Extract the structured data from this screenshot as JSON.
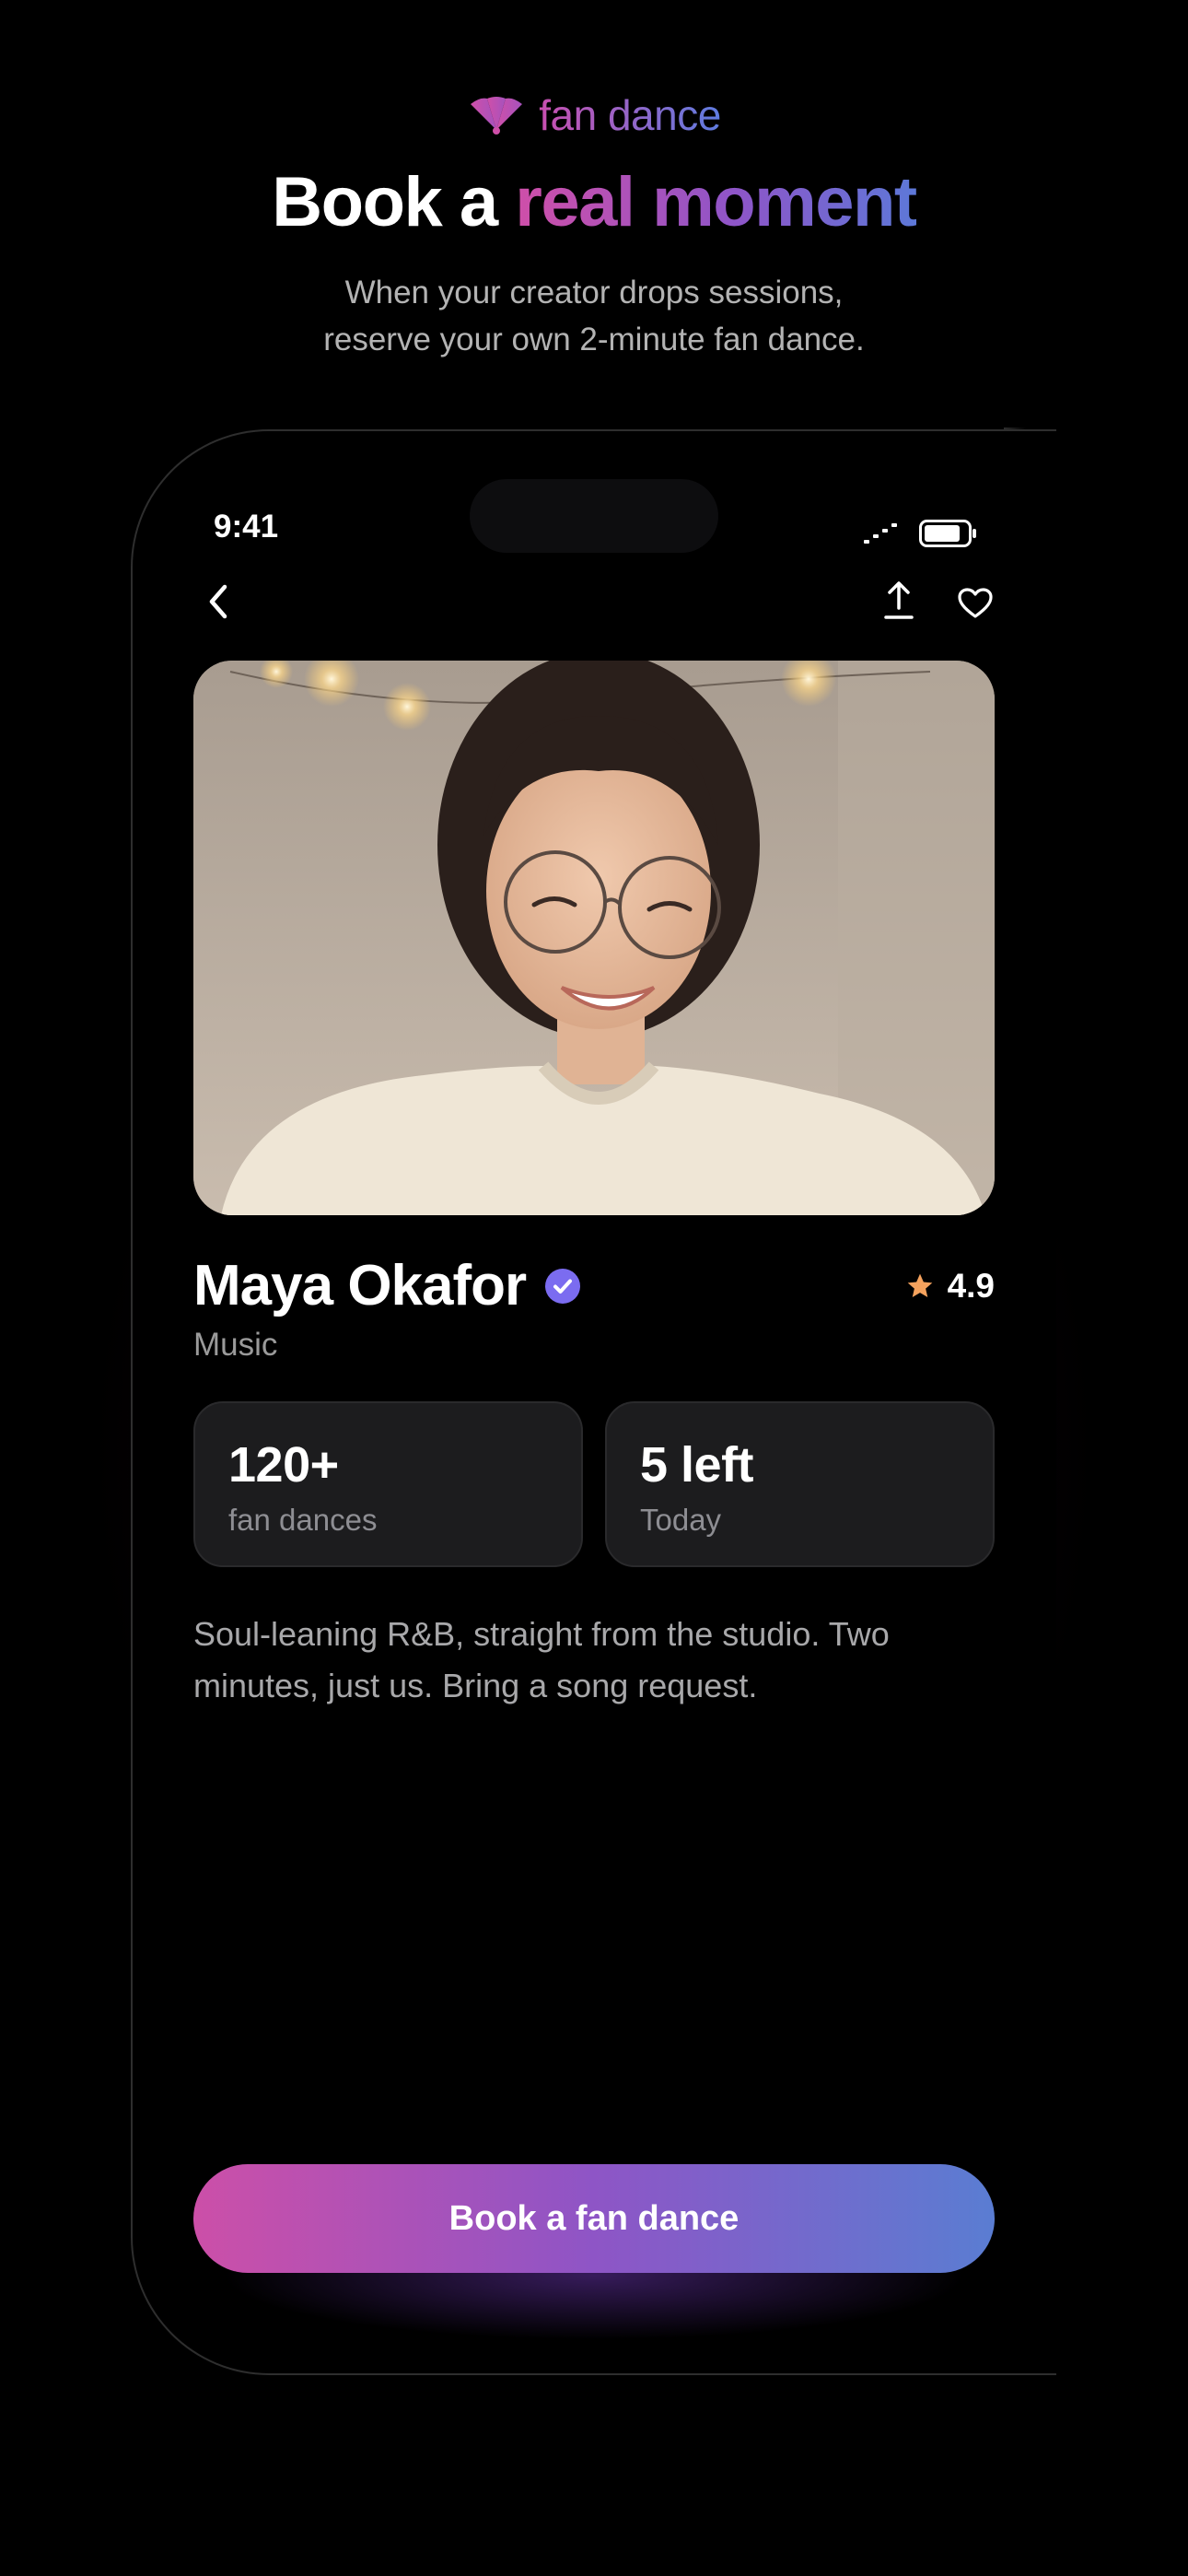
{
  "brand": {
    "name": "fan dance"
  },
  "hero": {
    "headline_plain": "Book a",
    "headline_accent": "real moment",
    "subhead_line1": "When your creator drops sessions,",
    "subhead_line2": "reserve your own 2-minute fan dance."
  },
  "status_bar": {
    "time": "9:41"
  },
  "creator": {
    "name": "Maya Okafor",
    "category": "Music",
    "rating": "4.9",
    "verified": true
  },
  "stats": [
    {
      "value": "120+",
      "label": "fan dances"
    },
    {
      "value": "5 left",
      "label": "Today"
    }
  ],
  "bio": "Soul-leaning R&B, straight from the studio. Two minutes, just us. Bring a song request.",
  "cta": {
    "label": "Book a fan dance"
  },
  "colors": {
    "accent_pink": "#cc4fa8",
    "accent_purple": "#8e55c6",
    "accent_blue": "#5a7dd2",
    "verified_badge": "#7b6cf0",
    "star": "#f5a25d"
  },
  "icons": {
    "back": "chevron-left-icon",
    "share": "share-icon",
    "favorite": "heart-icon",
    "verified": "verified-check-icon",
    "rating": "star-icon"
  }
}
